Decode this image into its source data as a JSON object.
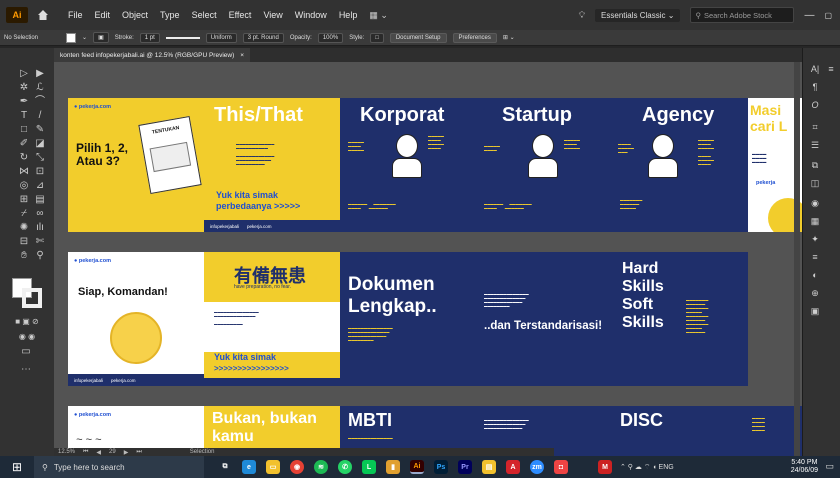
{
  "menubar": {
    "logo": "Ai",
    "menus": [
      "File",
      "Edit",
      "Object",
      "Type",
      "Select",
      "Effect",
      "View",
      "Window",
      "Help"
    ],
    "workspace": "Essentials Classic",
    "search_placeholder": "Search Adobe Stock"
  },
  "controlbar": {
    "selection": "No Selection",
    "stroke_label": "Stroke:",
    "stroke_value": "1 pt",
    "stroke_profile": "Uniform",
    "brush": "3 pt. Round",
    "opacity_label": "Opacity:",
    "opacity_value": "100%",
    "style_label": "Style:",
    "doc_setup": "Document Setup",
    "preferences": "Preferences"
  },
  "document_tab": {
    "title": "konten feed infopekerjabali.ai @ 12.5% (RGB/GPU Preview)",
    "close": "×"
  },
  "statusbar": {
    "zoom": "12.5%",
    "page": "29",
    "mode": "Selection"
  },
  "taskbar": {
    "search_placeholder": "Type here to search",
    "time": "5:40 PM",
    "date": "24/06/09",
    "lang": "ENG"
  },
  "slides": {
    "s1": {
      "brand": "pekerja.com",
      "title": "Pilih 1, 2, Atau 3?",
      "sign": "TENTUKAN"
    },
    "s2": {
      "title": "This/That",
      "cta": "Yuk kita simak perbedaanya >>>>>",
      "footer_left": "infopekerjabali",
      "footer_right": "pekerja.com"
    },
    "s3": {
      "title": "Korporat"
    },
    "s4": {
      "title": "Startup"
    },
    "s5": {
      "title": "Agency"
    },
    "s6": {
      "title": "Masi cari L",
      "brand": "pekerja"
    },
    "s7": {
      "brand": "pekerja.com",
      "title": "Siap, Komandan!",
      "footer_left": "infopekerjabali",
      "footer_right": "pekerja.com"
    },
    "s8": {
      "kanji": "有備無患",
      "subtitle": "have preparation, no fear.",
      "cta": "Yuk kita simak",
      "arrows": ">>>>>>>>>>>>>>>>"
    },
    "s9": {
      "title": "Dokumen Lengkap.."
    },
    "s10": {
      "title": "..dan Terstandarisasi!"
    },
    "s11": {
      "title": "Hard Skills Soft Skills"
    },
    "s12": {
      "title": ""
    },
    "s13": {
      "brand": "pekerja.com",
      "title": "Bukan, bukan kamu"
    },
    "s14": {
      "title": "MBTI"
    },
    "s15": {
      "title": ""
    },
    "s16": {
      "title": "DISC"
    }
  }
}
